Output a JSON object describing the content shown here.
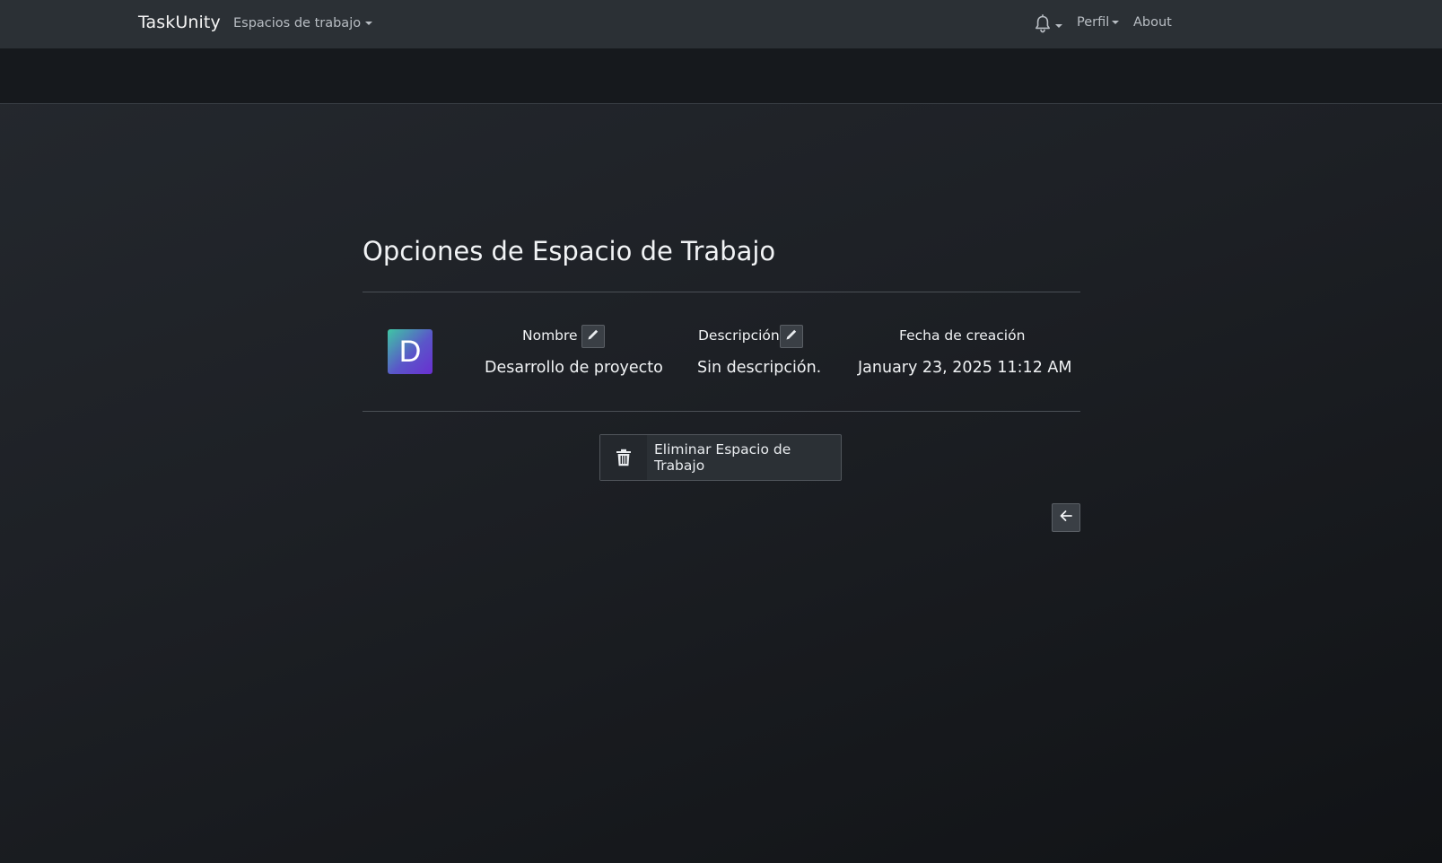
{
  "navbar": {
    "brand": "TaskUnity",
    "workspaces_label": "Espacios de trabajo",
    "profile_label": "Perfil",
    "about_label": "About",
    "notification_icon": "bell-icon"
  },
  "main": {
    "title": "Opciones de Espacio de Trabajo",
    "avatar_letter": "D",
    "avatar_colors": [
      "#3fc7a4",
      "#5a56c9",
      "#6a2fd1"
    ],
    "fields": {
      "name": {
        "label": "Nombre",
        "value": "Desarrollo de proyecto",
        "edit_icon": "pencil-icon"
      },
      "description": {
        "label": "Descripción",
        "value": "Sin descripción.",
        "edit_icon": "pencil-icon"
      },
      "created": {
        "label": "Fecha de creación",
        "value": "January 23, 2025 11:12 AM"
      }
    },
    "delete_button": {
      "label": "Eliminar Espacio de Trabajo",
      "icon": "trash-icon"
    },
    "back_button": {
      "icon": "arrow-left-icon"
    }
  },
  "colors": {
    "navbar_bg": "#2b3035",
    "page_bg": "#1d2025",
    "text": "#f1f3f5",
    "muted_text": "#b8bdc3"
  }
}
